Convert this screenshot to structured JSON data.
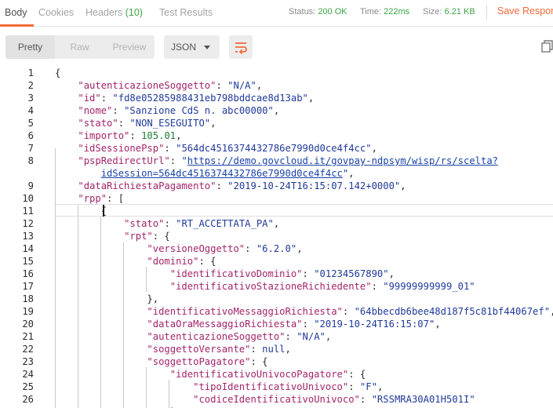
{
  "tabs": [
    {
      "label": "Body",
      "active": true
    },
    {
      "label": "Cookies",
      "active": false
    },
    {
      "label": "Headers",
      "count": "(10)",
      "active": false
    },
    {
      "label": "Test Results",
      "active": false
    }
  ],
  "status": {
    "status_label": "Status:",
    "status_value": "200 OK",
    "time_label": "Time:",
    "time_value": "222ms",
    "size_label": "Size:",
    "size_value": "6.21 KB"
  },
  "save_response_label": "Save Respor",
  "toolbar": {
    "view_modes": [
      {
        "label": "Pretty",
        "active": true
      },
      {
        "label": "Raw",
        "active": false
      },
      {
        "label": "Preview",
        "active": false
      }
    ],
    "format": "JSON",
    "icons": {
      "wrap": "wrap-lines-icon",
      "copy": "copy-icon"
    }
  },
  "colors": {
    "accent": "#f26b3a",
    "success": "#3aa545",
    "json_key": "#a2246b",
    "json_string": "#203a9a",
    "json_number": "#1e7a33"
  },
  "code_lines": [
    {
      "n": "1",
      "segs": [
        [
          "p",
          "{"
        ]
      ]
    },
    {
      "n": "2",
      "segs": [
        [
          "p",
          "    "
        ],
        [
          "key",
          "\"autenticazioneSoggetto\""
        ],
        [
          "p",
          ": "
        ],
        [
          "str",
          "\"N/A\""
        ],
        [
          "p",
          ","
        ]
      ]
    },
    {
      "n": "3",
      "segs": [
        [
          "p",
          "    "
        ],
        [
          "key",
          "\"id\""
        ],
        [
          "p",
          ": "
        ],
        [
          "str",
          "\"fd8e05285988431eb798bddcae8d13ab\""
        ],
        [
          "p",
          ","
        ]
      ]
    },
    {
      "n": "4",
      "segs": [
        [
          "p",
          "    "
        ],
        [
          "key",
          "\"nome\""
        ],
        [
          "p",
          ": "
        ],
        [
          "str",
          "\"Sanzione CdS n. abc00000\""
        ],
        [
          "p",
          ","
        ]
      ]
    },
    {
      "n": "5",
      "segs": [
        [
          "p",
          "    "
        ],
        [
          "key",
          "\"stato\""
        ],
        [
          "p",
          ": "
        ],
        [
          "str",
          "\"NON_ESEGUITO\""
        ],
        [
          "p",
          ","
        ]
      ]
    },
    {
      "n": "6",
      "segs": [
        [
          "p",
          "    "
        ],
        [
          "key",
          "\"importo\""
        ],
        [
          "p",
          ": "
        ],
        [
          "num",
          "105.01"
        ],
        [
          "p",
          ","
        ]
      ]
    },
    {
      "n": "7",
      "segs": [
        [
          "p",
          "    "
        ],
        [
          "key",
          "\"idSessionePsp\""
        ],
        [
          "p",
          ": "
        ],
        [
          "str",
          "\"564dc4516374432786e7990d0ce4f4cc\""
        ],
        [
          "p",
          ","
        ]
      ]
    },
    {
      "n": "8",
      "segs": [
        [
          "p",
          "    "
        ],
        [
          "key",
          "\"pspRedirectUrl\""
        ],
        [
          "p",
          ": "
        ],
        [
          "str",
          "\""
        ],
        [
          "url",
          "https://demo.govcloud.it/govpay-ndpsym/wisp/rs/scelta?"
        ]
      ]
    },
    {
      "n": "",
      "segs": [
        [
          "p",
          "        "
        ],
        [
          "url",
          "idSession=564dc4516374432786e7990d0ce4f4cc"
        ],
        [
          "str",
          "\""
        ],
        [
          "p",
          ","
        ]
      ]
    },
    {
      "n": "9",
      "segs": [
        [
          "p",
          "    "
        ],
        [
          "key",
          "\"dataRichiestaPagamento\""
        ],
        [
          "p",
          ": "
        ],
        [
          "str",
          "\"2019-10-24T16:15:07.142+0000\""
        ],
        [
          "p",
          ","
        ]
      ]
    },
    {
      "n": "10",
      "segs": [
        [
          "p",
          "    "
        ],
        [
          "key",
          "\"rpp\""
        ],
        [
          "p",
          ": ["
        ]
      ]
    },
    {
      "n": "11",
      "segs": [
        [
          "p",
          "        {"
        ]
      ]
    },
    {
      "n": "12",
      "segs": [
        [
          "p",
          "            "
        ],
        [
          "key",
          "\"stato\""
        ],
        [
          "p",
          ": "
        ],
        [
          "str",
          "\"RT_ACCETTATA_PA\""
        ],
        [
          "p",
          ","
        ]
      ]
    },
    {
      "n": "13",
      "segs": [
        [
          "p",
          "            "
        ],
        [
          "key",
          "\"rpt\""
        ],
        [
          "p",
          ": {"
        ]
      ]
    },
    {
      "n": "14",
      "segs": [
        [
          "p",
          "                "
        ],
        [
          "key",
          "\"versioneOggetto\""
        ],
        [
          "p",
          ": "
        ],
        [
          "str",
          "\"6.2.0\""
        ],
        [
          "p",
          ","
        ]
      ]
    },
    {
      "n": "15",
      "segs": [
        [
          "p",
          "                "
        ],
        [
          "key",
          "\"dominio\""
        ],
        [
          "p",
          ": {"
        ]
      ]
    },
    {
      "n": "16",
      "segs": [
        [
          "p",
          "                    "
        ],
        [
          "key",
          "\"identificativoDominio\""
        ],
        [
          "p",
          ": "
        ],
        [
          "str",
          "\"01234567890\""
        ],
        [
          "p",
          ","
        ]
      ]
    },
    {
      "n": "17",
      "segs": [
        [
          "p",
          "                    "
        ],
        [
          "key",
          "\"identificativoStazioneRichiedente\""
        ],
        [
          "p",
          ": "
        ],
        [
          "str",
          "\"99999999999_01\""
        ]
      ]
    },
    {
      "n": "18",
      "segs": [
        [
          "p",
          "                },"
        ]
      ]
    },
    {
      "n": "19",
      "segs": [
        [
          "p",
          "                "
        ],
        [
          "key",
          "\"identificativoMessaggioRichiesta\""
        ],
        [
          "p",
          ": "
        ],
        [
          "str",
          "\"64bbecdb6bee48d187f5c81bf44067ef\""
        ],
        [
          "p",
          ","
        ]
      ]
    },
    {
      "n": "20",
      "segs": [
        [
          "p",
          "                "
        ],
        [
          "key",
          "\"dataOraMessaggioRichiesta\""
        ],
        [
          "p",
          ": "
        ],
        [
          "str",
          "\"2019-10-24T16:15:07\""
        ],
        [
          "p",
          ","
        ]
      ]
    },
    {
      "n": "21",
      "segs": [
        [
          "p",
          "                "
        ],
        [
          "key",
          "\"autenticazioneSoggetto\""
        ],
        [
          "p",
          ": "
        ],
        [
          "str",
          "\"N/A\""
        ],
        [
          "p",
          ","
        ]
      ]
    },
    {
      "n": "22",
      "segs": [
        [
          "p",
          "                "
        ],
        [
          "key",
          "\"soggettoVersante\""
        ],
        [
          "p",
          ": "
        ],
        [
          "kw",
          "null"
        ],
        [
          "p",
          ","
        ]
      ]
    },
    {
      "n": "23",
      "segs": [
        [
          "p",
          "                "
        ],
        [
          "key",
          "\"soggettoPagatore\""
        ],
        [
          "p",
          ": {"
        ]
      ]
    },
    {
      "n": "24",
      "segs": [
        [
          "p",
          "                    "
        ],
        [
          "key",
          "\"identificativoUnivocoPagatore\""
        ],
        [
          "p",
          ": {"
        ]
      ]
    },
    {
      "n": "25",
      "segs": [
        [
          "p",
          "                        "
        ],
        [
          "key",
          "\"tipoIdentificativoUnivoco\""
        ],
        [
          "p",
          ": "
        ],
        [
          "str",
          "\"F\""
        ],
        [
          "p",
          ","
        ]
      ]
    },
    {
      "n": "26",
      "segs": [
        [
          "p",
          "                        "
        ],
        [
          "key",
          "\"codiceIdentificativoUnivoco\""
        ],
        [
          "p",
          ": "
        ],
        [
          "str",
          "\"RSSMRA30A01H501I\""
        ]
      ]
    },
    {
      "n": "",
      "segs": [
        [
          "p",
          "                    },"
        ]
      ]
    }
  ]
}
